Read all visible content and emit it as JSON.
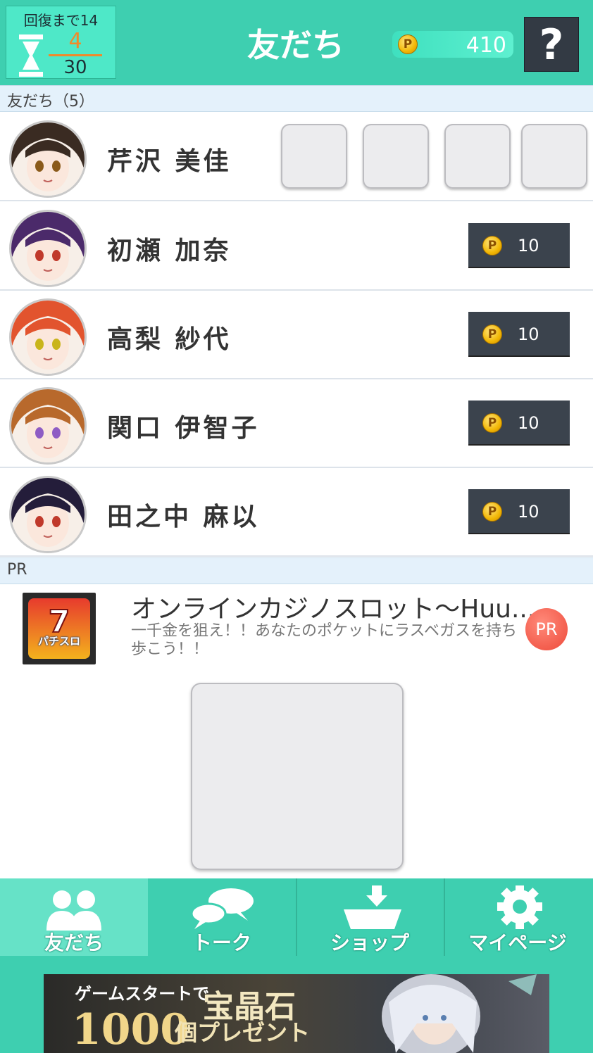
{
  "header": {
    "recovery_label": "回復まで14",
    "stamina_current": "4",
    "stamina_max": "30",
    "title": "友だち",
    "points": "410",
    "help_label": "?"
  },
  "friends_section": {
    "label": "友だち（5）"
  },
  "friends": [
    {
      "name": "芹沢 美佳",
      "hair": "#3a2b22",
      "eye": "#8a5a1a",
      "gift_slots": 4
    },
    {
      "name": "初瀬 加奈",
      "hair": "#4b2a6a",
      "eye": "#c0392b",
      "gift_cost": "10"
    },
    {
      "name": "高梨 紗代",
      "hair": "#e2542e",
      "eye": "#c9b41a",
      "gift_cost": "10"
    },
    {
      "name": "関口 伊智子",
      "hair": "#b8692c",
      "eye": "#8e5cc4",
      "gift_cost": "10"
    },
    {
      "name": "田之中 麻以",
      "hair": "#241d3a",
      "eye": "#c0392b",
      "gift_cost": "10"
    }
  ],
  "pr_section": {
    "label": "PR"
  },
  "ad": {
    "title": "オンラインカジノスロット〜Huu...",
    "description": "一千金を狙え！！あなたのポケットにラスベガスを持ち歩こう！！",
    "badge": "PR",
    "icon_text": "パチスロ"
  },
  "nav": [
    {
      "label": "友だち",
      "icon": "friends-icon",
      "active": true
    },
    {
      "label": "トーク",
      "icon": "chat-icon",
      "active": false
    },
    {
      "label": "ショップ",
      "icon": "shop-icon",
      "active": false
    },
    {
      "label": "マイページ",
      "icon": "gear-icon",
      "active": false
    }
  ],
  "banner": {
    "line1": "ゲームスタートで",
    "headline": "宝晶石",
    "amount": "1000",
    "line2": "個プレゼント"
  },
  "colors": {
    "accent": "#3ecfb0",
    "stamina": "#f08a2a",
    "button_dark": "#3b434d",
    "section_bg": "#e4f1fb"
  }
}
